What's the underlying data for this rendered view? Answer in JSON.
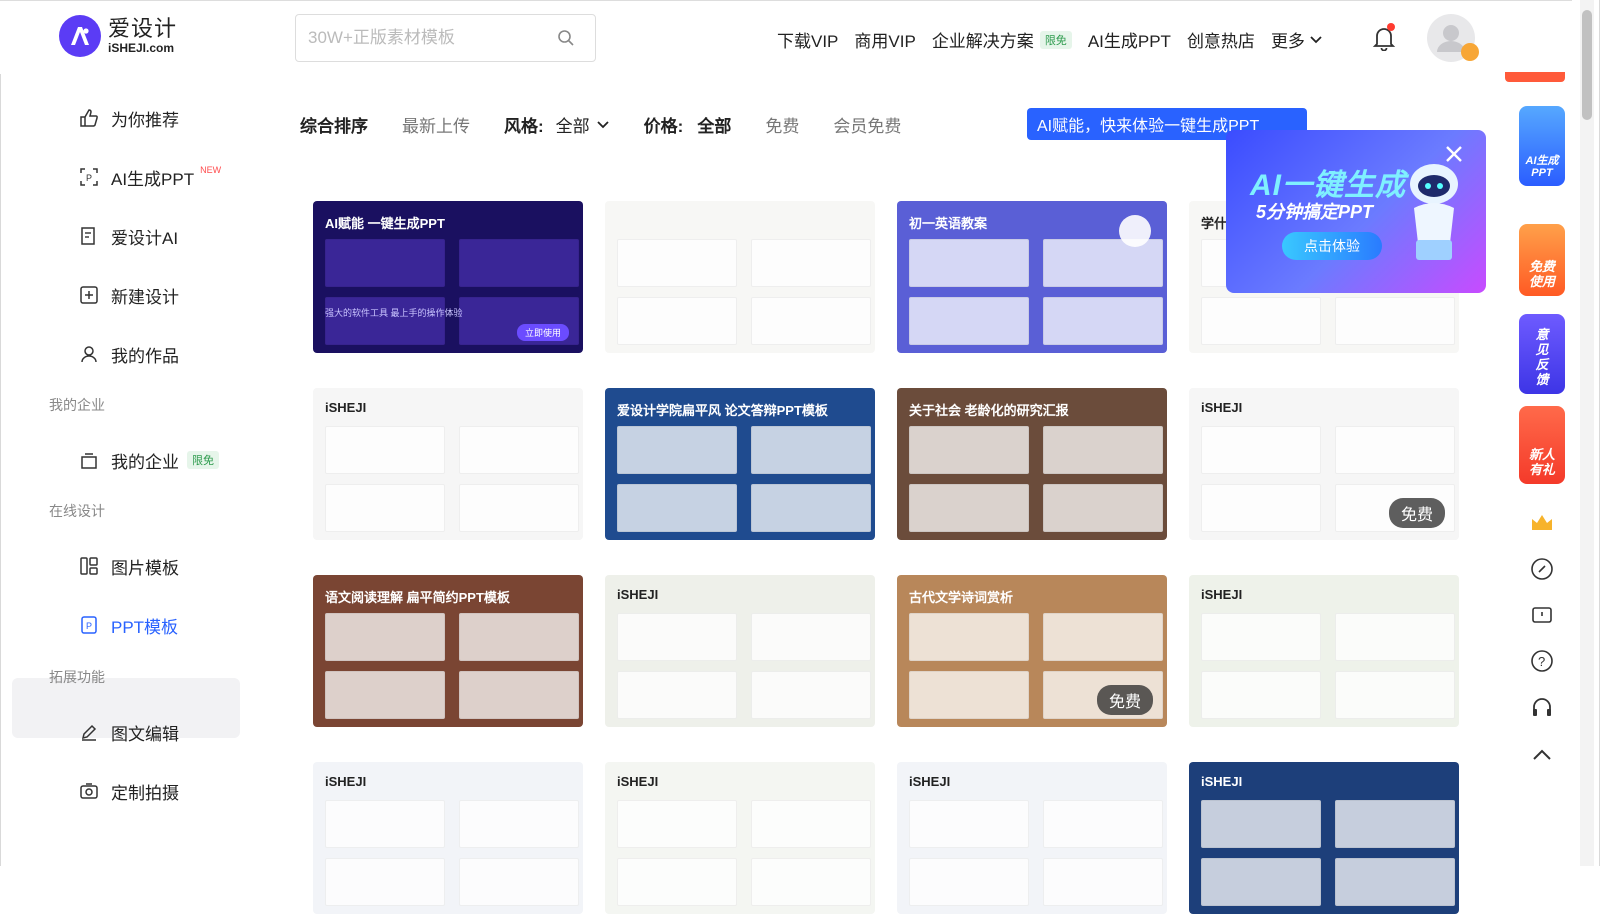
{
  "header": {
    "logo_cn": "爱设计",
    "logo_en": "iSHEJI.com",
    "search_placeholder": "30W+正版素材模板",
    "nav": [
      "下载VIP",
      "商用VIP",
      "企业解决方案",
      "AI生成PPT",
      "创意热店",
      "更多"
    ],
    "nav_badge": "限免"
  },
  "sidebar": {
    "items": [
      {
        "label": "为你推荐"
      },
      {
        "label": "AI生成PPT",
        "tag": "NEW"
      },
      {
        "label": "爱设计AI"
      },
      {
        "label": "新建设计"
      },
      {
        "label": "我的作品"
      }
    ],
    "group_enterprise": "我的企业",
    "enterprise_item": "我的企业",
    "enterprise_tag": "限免",
    "group_online": "在线设计",
    "online_items": [
      {
        "label": "图片模板"
      },
      {
        "label": "PPT模板"
      }
    ],
    "group_ext": "拓展功能",
    "ext_items": [
      {
        "label": "图文编辑"
      },
      {
        "label": "定制拍摄"
      }
    ]
  },
  "filters": {
    "sort_all": "综合排序",
    "sort_new": "最新上传",
    "style_label": "风格:",
    "style_value": "全部",
    "price_label": "价格:",
    "price_all": "全部",
    "price_free": "免费",
    "price_member": "会员免费"
  },
  "ai_banner": "AI赋能，快来体验一键生成PPT",
  "popup": {
    "title": "AI一键生成",
    "subtitle": "5分钟搞定PPT",
    "button": "点击体验"
  },
  "cards": [
    {
      "title": "AI赋能 一键生成PPT",
      "sub": "强大的软件工具 最上手的操作体验",
      "cta": "立即使用",
      "bg": "#1a1060"
    },
    {
      "title": "",
      "bg": "#f7f7f5"
    },
    {
      "title": "初一英语教案",
      "bg": "#5a5fd6"
    },
    {
      "title": "学什么",
      "bg": "#f7f7f5"
    },
    {
      "title": "iSHEJI",
      "bg": "#f6f6f6"
    },
    {
      "title": "爱设计学院扁平风 论文答辩PPT模板",
      "bg": "#1f4b8f"
    },
    {
      "title": "关于社会 老龄化的研究汇报",
      "bg": "#6b4c3b"
    },
    {
      "title": "iSHEJI",
      "bg": "#f6f6f6"
    },
    {
      "title": "语文阅读理解 扁平简约PPT模板",
      "bg": "#7a4533"
    },
    {
      "title": "iSHEJI",
      "bg": "#eef0ea"
    },
    {
      "title": "古代文学诗词赏析",
      "bg": "#b8875a"
    },
    {
      "title": "iSHEJI",
      "bg": "#eef2ea"
    },
    {
      "title": "iSHEJI",
      "bg": "#f2f4f8"
    },
    {
      "title": "iSHEJI",
      "bg": "#f4f6f2"
    },
    {
      "title": "iSHEJI",
      "bg": "#f2f4f8"
    },
    {
      "title": "iSHEJI",
      "bg": "#1d3f7a"
    }
  ],
  "free_label": "免费",
  "rail": {
    "ai_ppt": "AI生成PPT",
    "free_use": "免费使用",
    "feedback": "意见反馈",
    "gift": "新人有礼"
  }
}
